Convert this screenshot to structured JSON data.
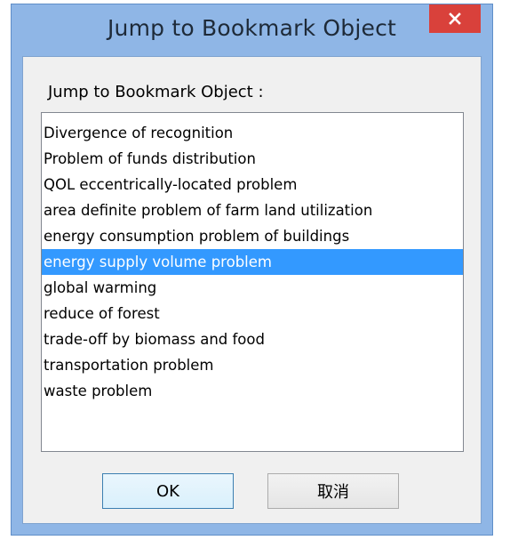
{
  "window": {
    "title": "Jump to Bookmark Object",
    "close_icon": "close-icon",
    "colors": {
      "frame": "#8fb6e6",
      "close_button": "#d9413b",
      "selection": "#3399ff"
    }
  },
  "dialog": {
    "list_label": "Jump to Bookmark Object :",
    "items": [
      {
        "label": "Divergence of recognition",
        "selected": false
      },
      {
        "label": "Problem of funds distribution",
        "selected": false
      },
      {
        "label": "QOL eccentrically-located problem",
        "selected": false
      },
      {
        "label": "area definite problem of farm land utilization",
        "selected": false
      },
      {
        "label": "energy consumption problem of buildings",
        "selected": false
      },
      {
        "label": "energy supply volume problem",
        "selected": true
      },
      {
        "label": "global warming",
        "selected": false
      },
      {
        "label": "reduce of forest",
        "selected": false
      },
      {
        "label": "trade-off by biomass and food",
        "selected": false
      },
      {
        "label": "transportation problem",
        "selected": false
      },
      {
        "label": "waste problem",
        "selected": false
      }
    ],
    "ok_label": "OK",
    "cancel_label": "取消"
  }
}
